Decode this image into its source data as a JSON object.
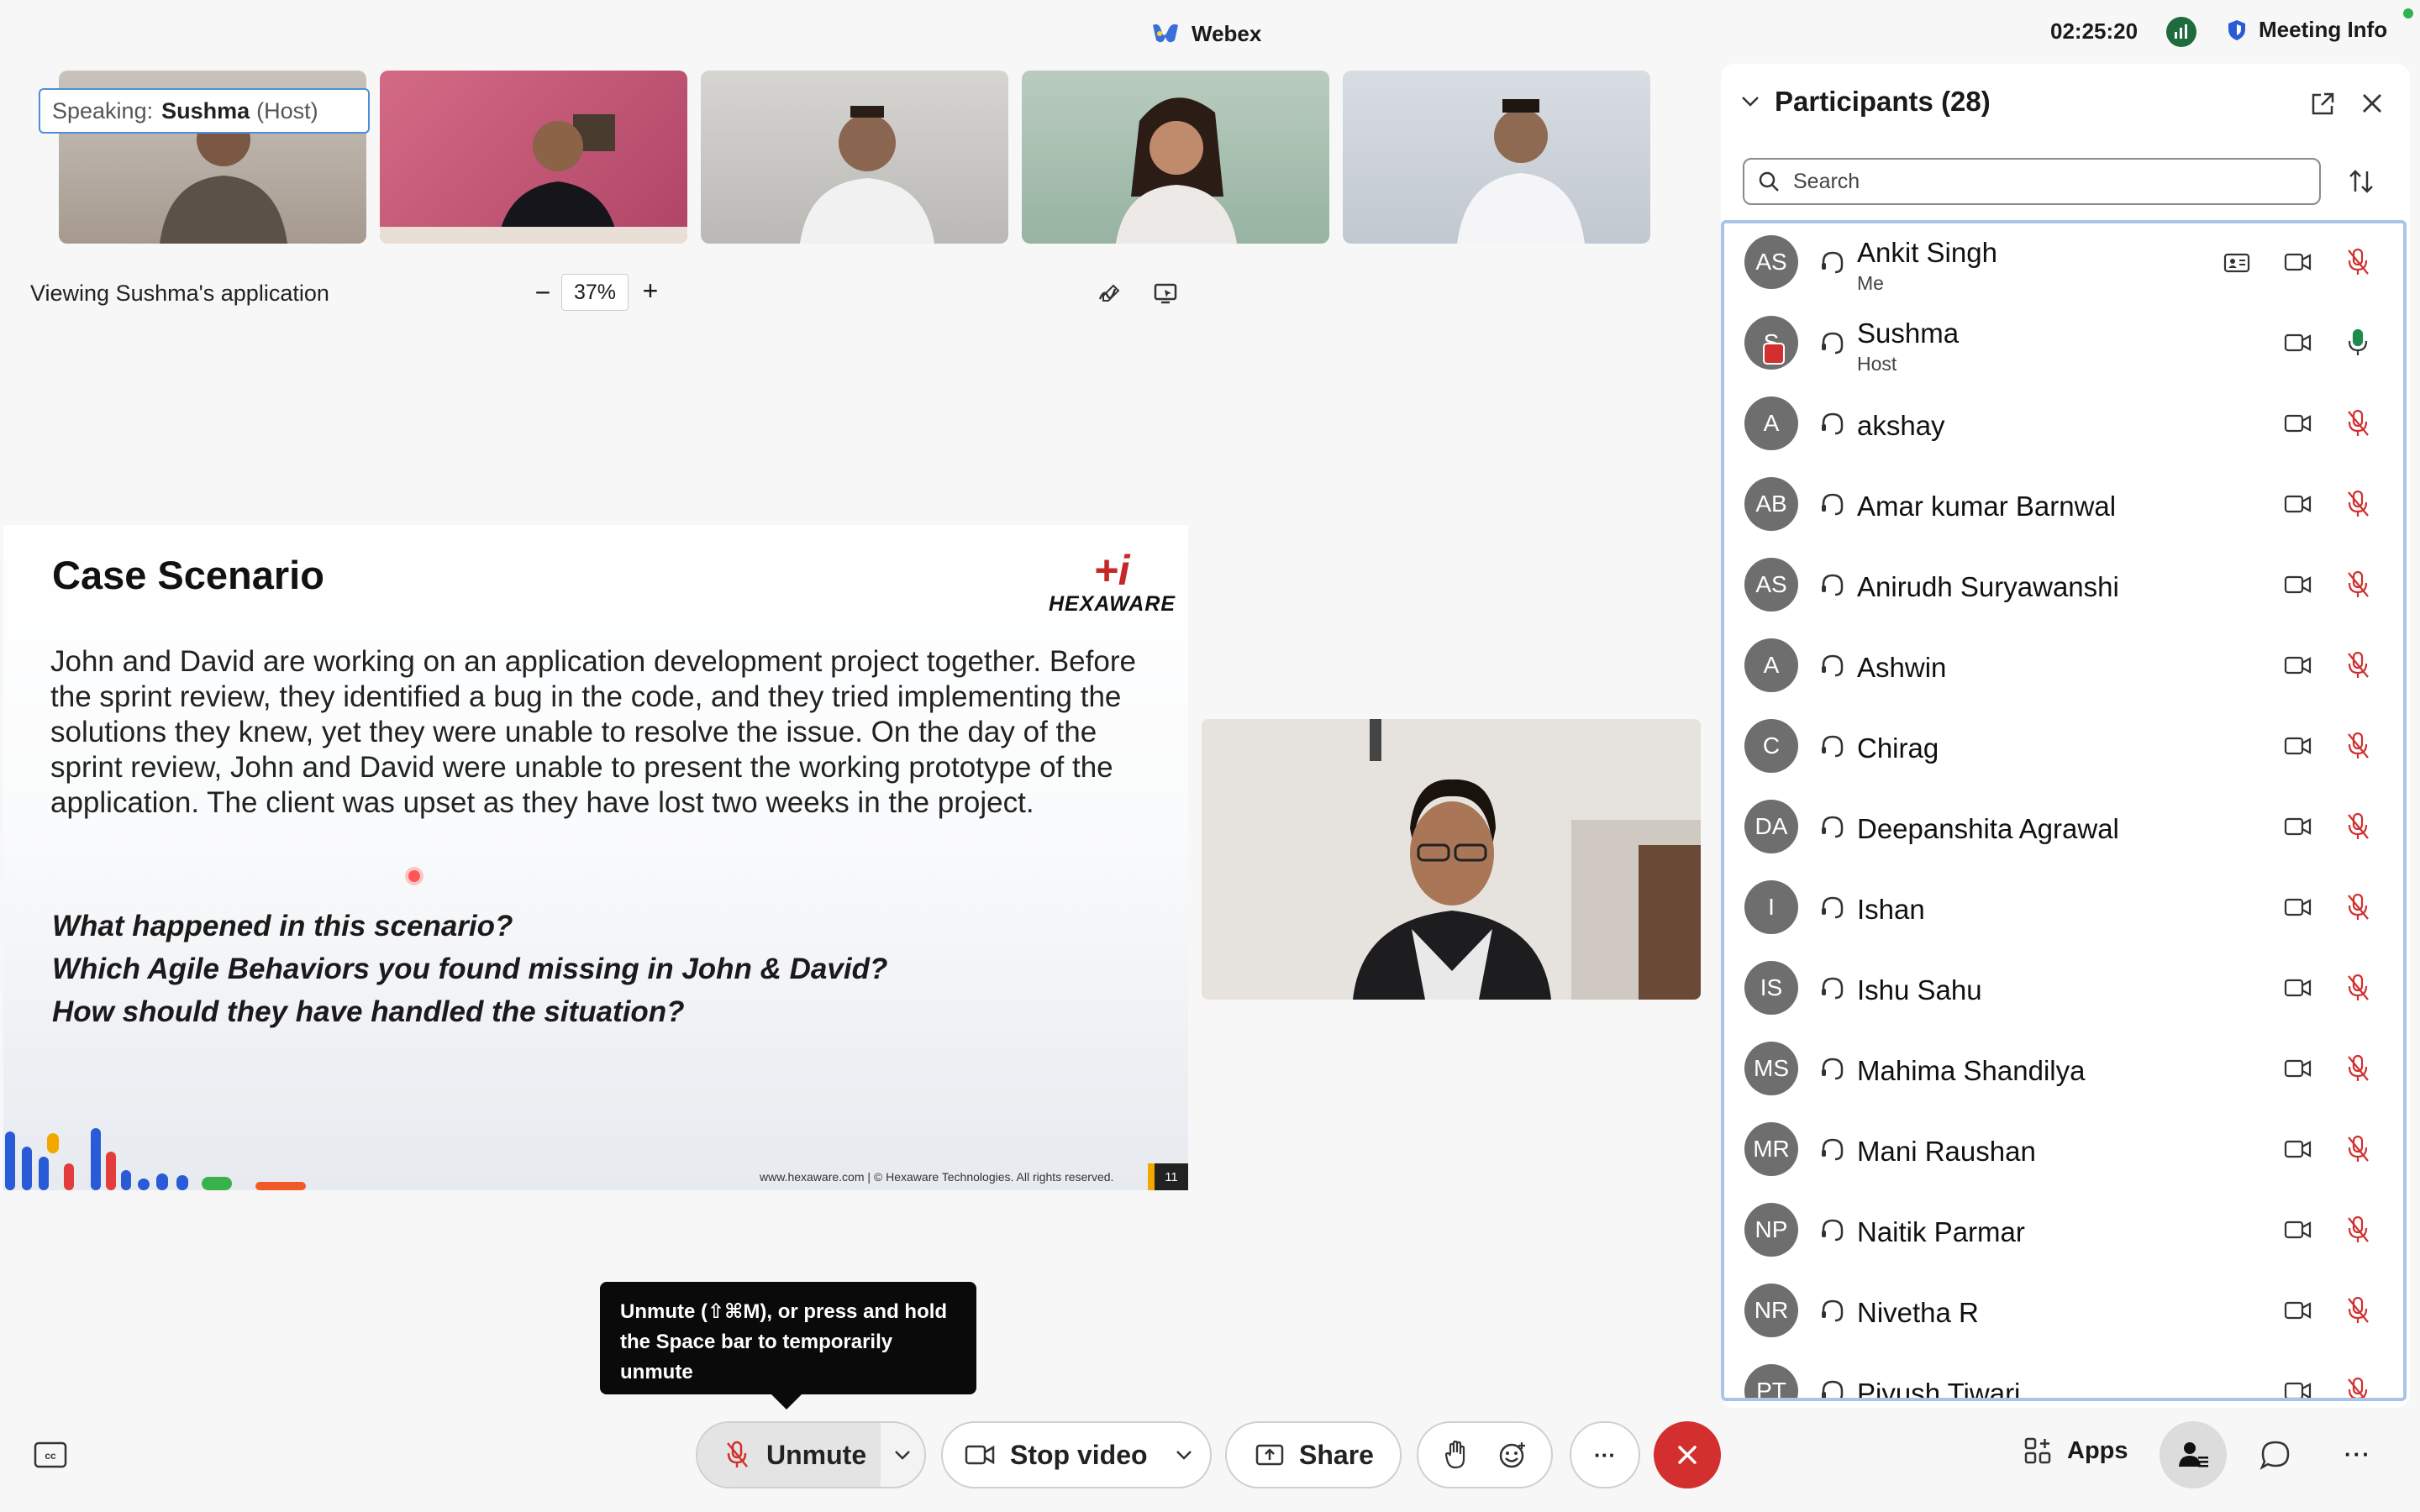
{
  "app": {
    "name": "Webex",
    "time": "02:25:20",
    "meeting_info": "Meeting Info"
  },
  "stage": {
    "speaking_label": "Speaking:",
    "speaking_name": "Sushma",
    "speaking_role": "(Host)",
    "viewing": "Viewing Sushma's application",
    "zoom_out": "−",
    "zoom": "37%",
    "zoom_in": "+"
  },
  "slide": {
    "title": "Case Scenario",
    "logo_text": "HEXAWARE",
    "body": "John and David are working on an application development project together. Before the sprint review, they identified a bug in the code, and they tried implementing the solutions they knew, yet they were unable to resolve the issue. On the day of the sprint review, John and David were unable to present the working prototype of the application. The client was upset as they have lost two weeks in the project.",
    "questions": [
      "What happened in this scenario?",
      "Which Agile Behaviors you found missing in John & David?",
      "How should they have handled the situation?"
    ],
    "footer": "www.hexaware.com  | © Hexaware Technologies. All rights reserved.",
    "page": "11"
  },
  "tooltip": "Unmute (⇧⌘M), or press and hold the Space bar to temporarily unmute",
  "controls": {
    "unmute": "Unmute",
    "stop_video": "Stop video",
    "share": "Share",
    "more": "···",
    "apps": "Apps",
    "bottom_more": "···"
  },
  "participants": {
    "title": "Participants (28)",
    "search_placeholder": "Search",
    "list": [
      {
        "initials": "AS",
        "name": "Ankit Singh",
        "sub": "Me",
        "mic": "muted",
        "card": true
      },
      {
        "initials": "S",
        "name": "Sushma",
        "sub": "Host",
        "mic": "active",
        "sharing": true
      },
      {
        "initials": "A",
        "name": "akshay",
        "sub": "",
        "mic": "muted"
      },
      {
        "initials": "AB",
        "name": "Amar kumar Barnwal",
        "sub": "",
        "mic": "muted"
      },
      {
        "initials": "AS",
        "name": "Anirudh Suryawanshi",
        "sub": "",
        "mic": "muted"
      },
      {
        "initials": "A",
        "name": "Ashwin",
        "sub": "",
        "mic": "muted"
      },
      {
        "initials": "C",
        "name": "Chirag",
        "sub": "",
        "mic": "muted"
      },
      {
        "initials": "DA",
        "name": "Deepanshita Agrawal",
        "sub": "",
        "mic": "muted"
      },
      {
        "initials": "I",
        "name": "Ishan",
        "sub": "",
        "mic": "muted"
      },
      {
        "initials": "IS",
        "name": "Ishu Sahu",
        "sub": "",
        "mic": "muted"
      },
      {
        "initials": "MS",
        "name": "Mahima Shandilya",
        "sub": "",
        "mic": "muted"
      },
      {
        "initials": "MR",
        "name": "Mani Raushan",
        "sub": "",
        "mic": "muted"
      },
      {
        "initials": "NP",
        "name": "Naitik Parmar",
        "sub": "",
        "mic": "muted"
      },
      {
        "initials": "NR",
        "name": "Nivetha R",
        "sub": "",
        "mic": "muted"
      },
      {
        "initials": "PT",
        "name": "Piyush Tiwari",
        "sub": "",
        "mic": "muted"
      }
    ]
  },
  "colors": {
    "end_call": "#d32f2f",
    "muted_icon": "#d32f2f",
    "active_mic": "#1e8a4c",
    "panel_focus": "#a9c4ea"
  }
}
